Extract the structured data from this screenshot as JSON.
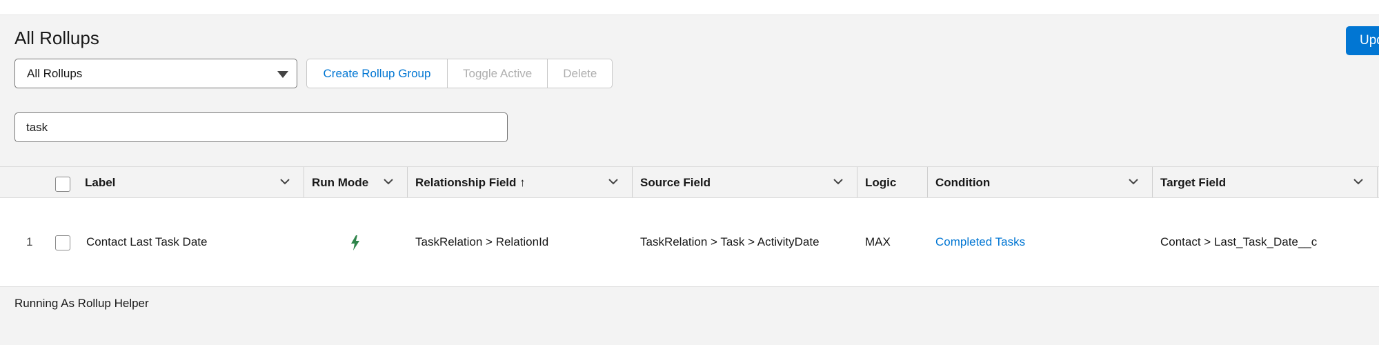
{
  "header": {
    "title": "All Rollups",
    "update_button": "Upd"
  },
  "filter": {
    "selected": "All Rollups"
  },
  "toolbar": {
    "create": "Create Rollup Group",
    "toggle": "Toggle Active",
    "delete": "Delete"
  },
  "search": {
    "value": "task"
  },
  "table": {
    "columns": {
      "label": "Label",
      "run_mode": "Run Mode",
      "relationship": "Relationship Field ↑",
      "source": "Source Field",
      "logic": "Logic",
      "condition": "Condition",
      "target": "Target Field"
    },
    "rows": [
      {
        "num": "1",
        "label": "Contact Last Task Date",
        "run_mode_icon": "lightning-bolt-icon",
        "relationship": "TaskRelation > RelationId",
        "source": "TaskRelation > Task > ActivityDate",
        "logic": "MAX",
        "condition": "Completed Tasks",
        "target": "Contact > Last_Task_Date__c"
      }
    ]
  },
  "footer": {
    "status": "Running As Rollup Helper"
  },
  "colors": {
    "brand": "#0176d3",
    "run_mode_icon": "#2e844a"
  }
}
